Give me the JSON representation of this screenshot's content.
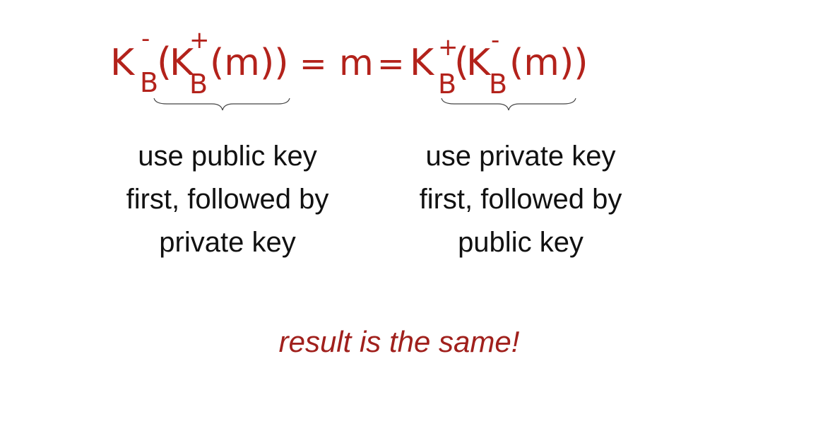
{
  "formula": {
    "color": "#b3221b",
    "left_side": {
      "outer_key": "K",
      "outer_sup": "-",
      "outer_sub": "B",
      "open": "(",
      "inner_key": "K",
      "inner_sup": "+",
      "inner_sub": "B",
      "argument": "(m))"
    },
    "equals_1": "=",
    "middle": "m",
    "equals_2": "=",
    "right_side": {
      "outer_key": "K",
      "outer_sup": "+",
      "outer_sub": "B",
      "open": "(",
      "inner_key": "K",
      "inner_sup": "-",
      "inner_sub": "B",
      "argument": "(m))"
    }
  },
  "captions": {
    "left": [
      "use public key",
      "first, followed by",
      "private key"
    ],
    "right": [
      "use private key",
      "first, followed by",
      "public key"
    ]
  },
  "conclusion": "result is the same!"
}
